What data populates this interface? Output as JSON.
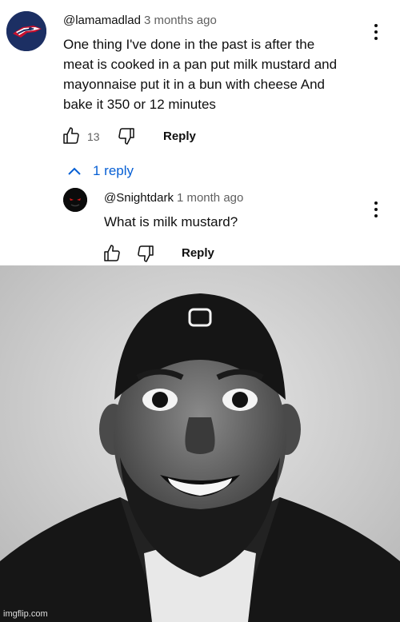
{
  "comment": {
    "author": "@lamamadlad",
    "time": "3 months ago",
    "text_lines": [
      "One thing I've done in the past is after the",
      "meat is cooked in a pan put milk mustard and",
      "mayonnaise put it in a bun with cheese And",
      "bake it 350 or 12 minutes"
    ],
    "likes": "13",
    "reply_label": "Reply",
    "replies_toggle": "1 reply"
  },
  "reply": {
    "author": "@Snightdark",
    "time": "1 month ago",
    "text": "What is milk mustard?",
    "reply_label": "Reply"
  },
  "watermark": "imgflip.com",
  "colors": {
    "link_blue": "#065fd4",
    "muted_text": "#606060",
    "avatar_navy": "#1c2f63"
  },
  "icons": [
    "thumbs-up-icon",
    "thumbs-down-icon",
    "chevron-up-icon",
    "more-vert-icon"
  ]
}
